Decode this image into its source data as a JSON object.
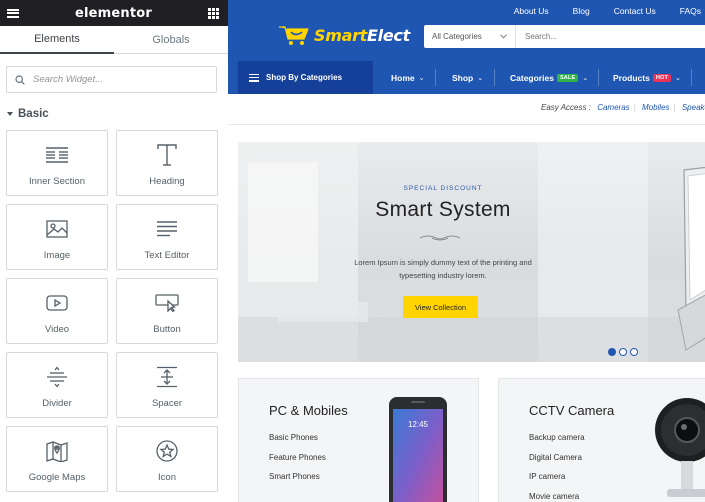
{
  "editor": {
    "logo": "elementor",
    "tabs": [
      "Elements",
      "Globals"
    ],
    "active_tab": "Elements",
    "search_placeholder": "Search Widget...",
    "category": "Basic",
    "widgets": [
      {
        "label": "Inner Section",
        "icon": "inner-section-icon"
      },
      {
        "label": "Heading",
        "icon": "heading-icon"
      },
      {
        "label": "Image",
        "icon": "image-icon"
      },
      {
        "label": "Text Editor",
        "icon": "text-editor-icon"
      },
      {
        "label": "Video",
        "icon": "video-icon"
      },
      {
        "label": "Button",
        "icon": "button-icon"
      },
      {
        "label": "Divider",
        "icon": "divider-icon"
      },
      {
        "label": "Spacer",
        "icon": "spacer-icon"
      },
      {
        "label": "Google Maps",
        "icon": "google-maps-icon"
      },
      {
        "label": "Icon",
        "icon": "star-icon"
      }
    ]
  },
  "site": {
    "top_links": [
      "About Us",
      "Blog",
      "Contact Us",
      "FAQs"
    ],
    "brand": {
      "part1": "Smart",
      "part2": "Elect"
    },
    "category_select": "All Categories",
    "search_placeholder": "Search...",
    "shop_by": "Shop By Categories",
    "nav": [
      {
        "label": "Home",
        "badge": ""
      },
      {
        "label": "Shop",
        "badge": ""
      },
      {
        "label": "Categories",
        "badge": "SALE",
        "badge_color": "#2fb34a"
      },
      {
        "label": "Products",
        "badge": "HOT",
        "badge_color": "#e8335a"
      }
    ],
    "easy_access": {
      "label": "Easy Access :",
      "links": [
        "Cameras",
        "Mobiles",
        "Speakers"
      ]
    },
    "hero": {
      "kicker": "SPECIAL DISCOUNT",
      "title": "Smart System",
      "desc_line1": "Lorem Ipsum is simply dummy text of the printing and",
      "desc_line2": "typesetting industry lorem.",
      "button": "View Collection",
      "slides": 3,
      "active_slide": 1
    },
    "cards": [
      {
        "title": "PC & Mobiles",
        "items": [
          "Basic Phones",
          "Feature Phones",
          "Smart Phones"
        ]
      },
      {
        "title": "CCTV Camera",
        "items": [
          "Backup camera",
          "Digital Camera",
          "IP camera",
          "Movie camera"
        ]
      }
    ],
    "colors": {
      "primary": "#1f56b2",
      "accent": "#ffd400",
      "dark": "#1f1f24"
    }
  }
}
